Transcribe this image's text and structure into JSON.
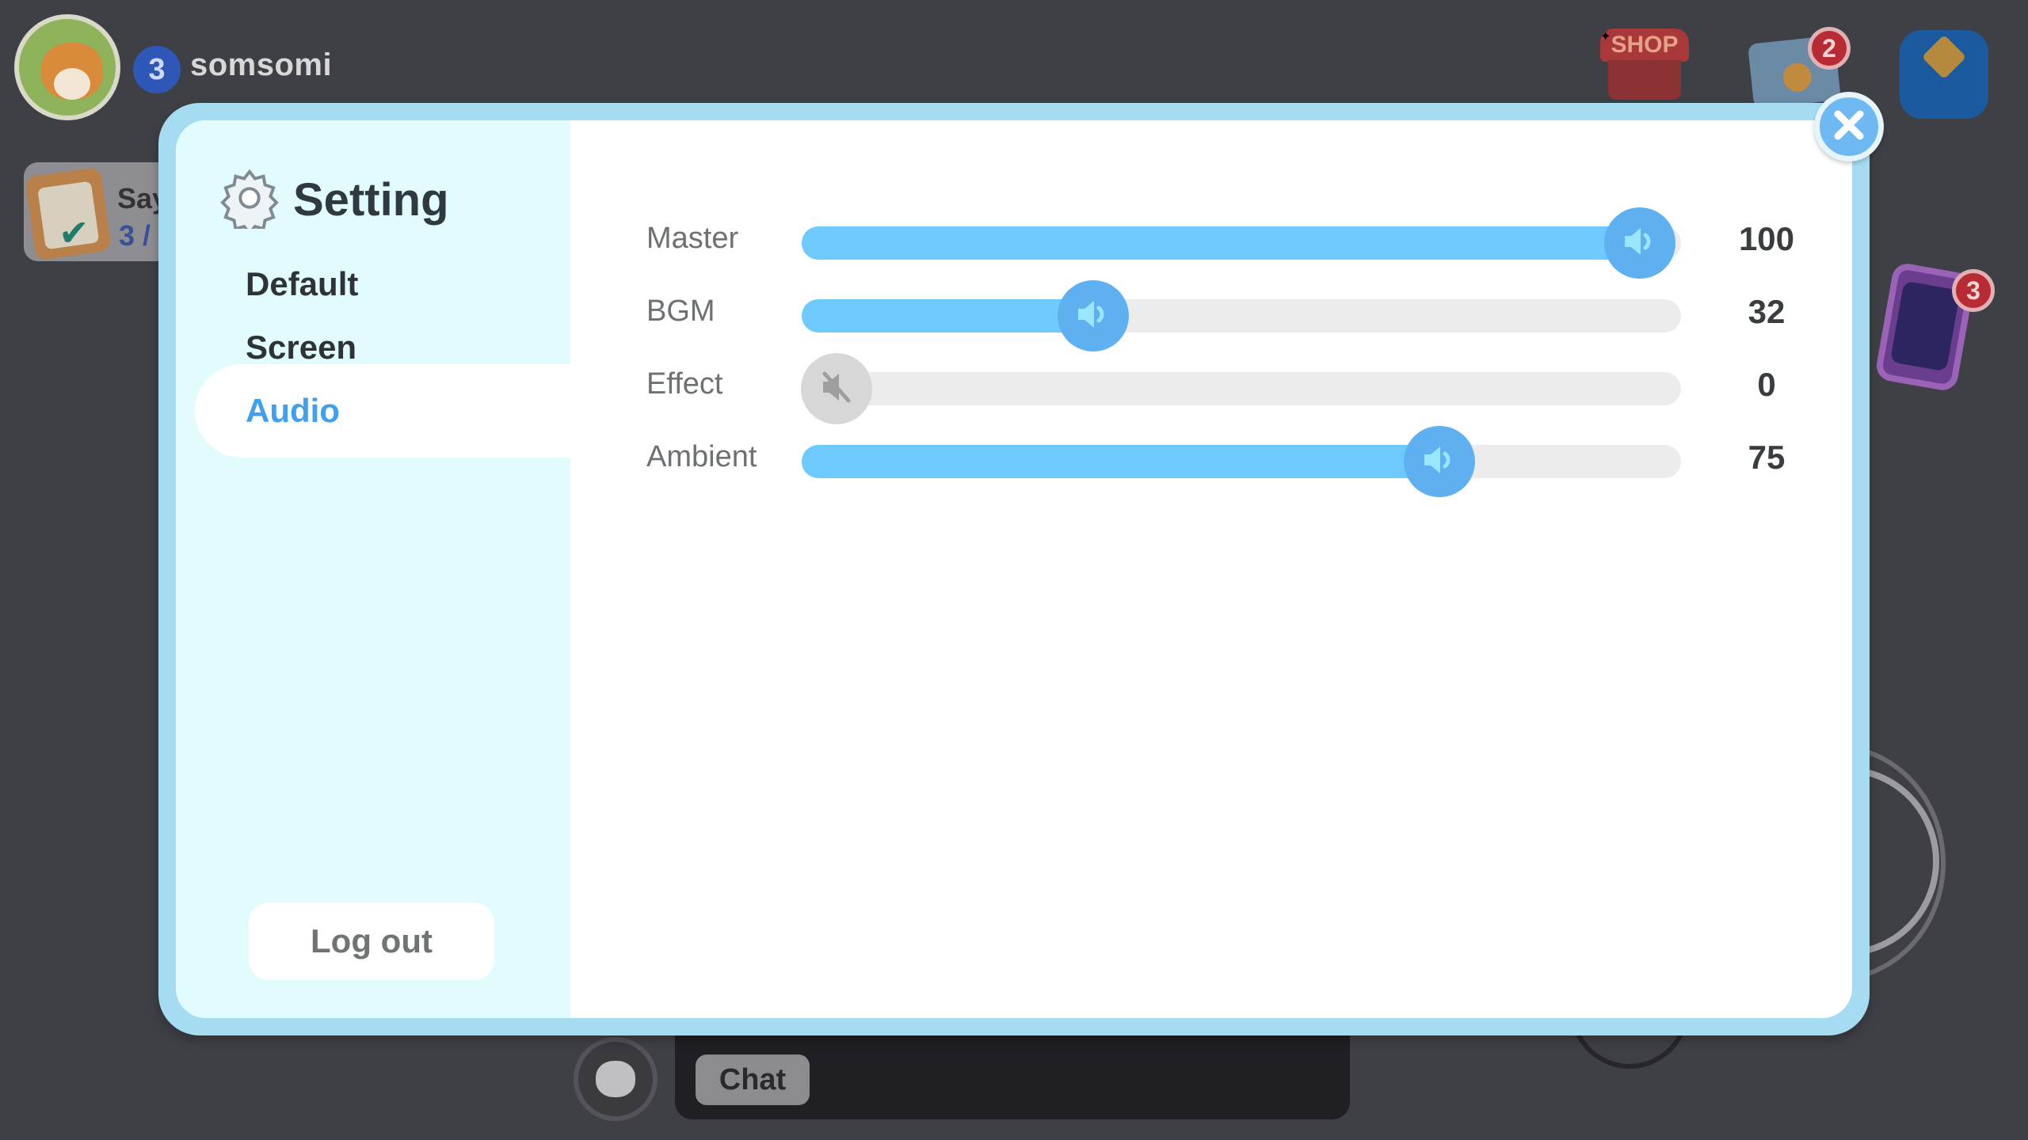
{
  "player": {
    "level": "3",
    "username": "somsomi"
  },
  "quest": {
    "title": "Say",
    "progress": "3 /"
  },
  "hud": {
    "shop_label": "SHOP",
    "mail_badge": "2",
    "phone_badge": "3",
    "chat_label": "Chat"
  },
  "settings": {
    "title": "Setting",
    "nav": [
      {
        "label": "Default"
      },
      {
        "label": "Screen"
      },
      {
        "label": "Audio"
      }
    ],
    "active_tab": "Audio",
    "logout_label": "Log out",
    "audio": [
      {
        "label": "Master",
        "value": "100",
        "level": 1.0,
        "muted": false
      },
      {
        "label": "BGM",
        "value": "32",
        "level": 0.32,
        "muted": false
      },
      {
        "label": "Effect",
        "value": "0",
        "level": 0.0,
        "muted": true
      },
      {
        "label": "Ambient",
        "value": "75",
        "level": 0.75,
        "muted": false
      }
    ]
  },
  "colors": {
    "accent": "#3ea0ee",
    "slider_fill": "#6ecafc",
    "knob": "#5eb0f0",
    "modal_frame": "#a6dcf2",
    "sidebar_bg": "#e2fcfd"
  },
  "icons": {
    "settings": "gear-icon",
    "volume": "speaker-icon",
    "muted": "speaker-muted-icon",
    "close": "close-icon"
  }
}
